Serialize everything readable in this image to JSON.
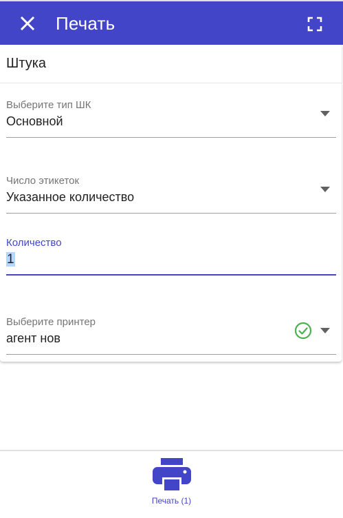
{
  "header": {
    "title": "Печать",
    "close_icon": "close-icon",
    "fullscreen_icon": "fullscreen-icon",
    "background": "#4245c7"
  },
  "item": {
    "name": "Штука"
  },
  "fields": {
    "barcode_type": {
      "label": "Выберите тип ШК",
      "value": "Основной"
    },
    "label_count": {
      "label": "Число этикеток",
      "value": "Указанное количество"
    },
    "quantity": {
      "label": "Количество",
      "value": "1"
    },
    "printer": {
      "label": "Выберите принтер",
      "value": "агент нов",
      "status_icon": "check-circle-icon",
      "status_color": "#4caf50"
    }
  },
  "footer": {
    "print_button_label": "Печать (1)",
    "print_icon": "printer-icon",
    "accent": "#4245c7"
  }
}
